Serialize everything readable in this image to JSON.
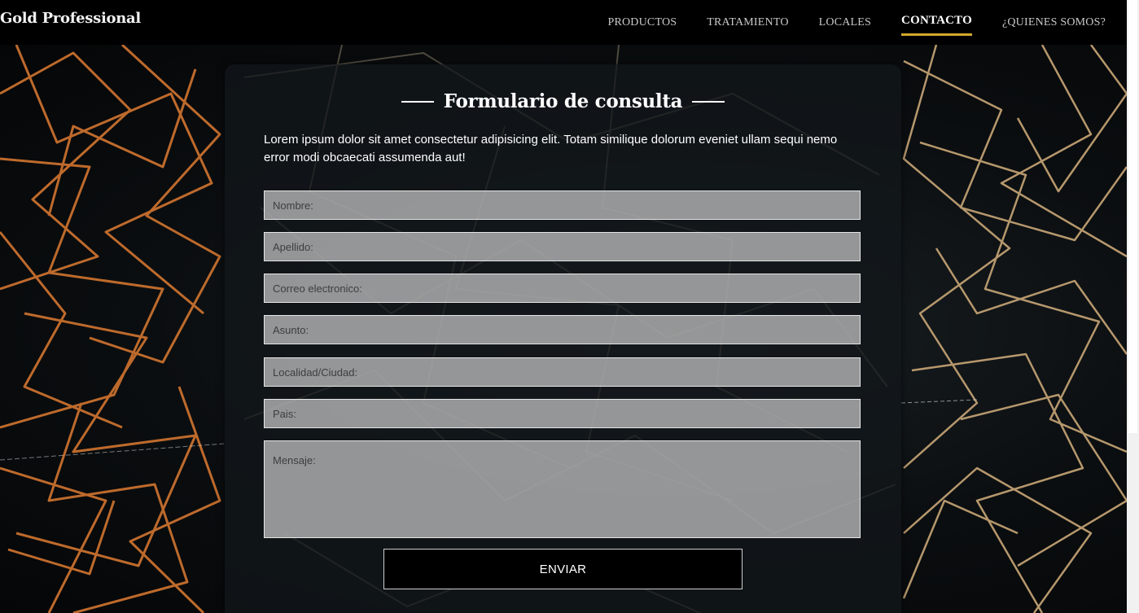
{
  "header": {
    "brand": "Gold Professional",
    "nav": [
      {
        "label": "PRODUCTOS"
      },
      {
        "label": "TRATAMIENTO"
      },
      {
        "label": "LOCALES"
      },
      {
        "label": "CONTACTO",
        "active": true
      },
      {
        "label": "¿QUIENES SOMOS?"
      }
    ]
  },
  "form": {
    "title": "Formulario de consulta",
    "intro": "Lorem ipsum dolor sit amet consectetur adipisicing elit. Totam similique dolorum eveniet ullam sequi nemo error modi obcaecati assumenda aut!",
    "fields": {
      "nombre": "Nombre:",
      "apellido": "Apellido:",
      "correo": "Correo electronico:",
      "asunto": "Asunto:",
      "localidad": "Localidad/Ciudad:",
      "pais": "Pais:",
      "mensaje": "Mensaje:"
    },
    "submit_label": "ENVIAR"
  },
  "colors": {
    "accent": "#d4a72c",
    "line_left": "#c8702e",
    "line_right": "#c9a777"
  }
}
